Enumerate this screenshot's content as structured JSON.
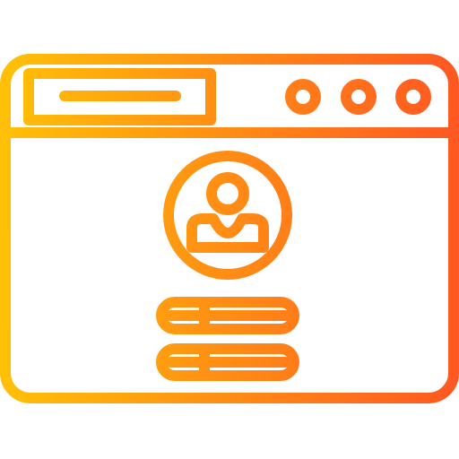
{
  "icon": {
    "name": "browser-user-profile-icon",
    "colors": {
      "gradient_start": "#FFC107",
      "gradient_end": "#FF5722",
      "background": "#FFFFFF"
    },
    "window_controls_count": 3,
    "form_fields_count": 2
  }
}
